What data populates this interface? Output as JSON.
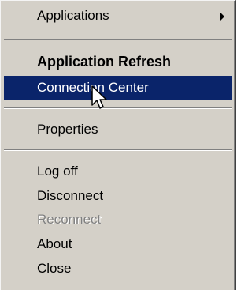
{
  "menu": {
    "applications": {
      "label": "Applications",
      "has_submenu": true
    },
    "items_group1": [
      {
        "label": "Application Refresh",
        "bold": true
      },
      {
        "label": "Connection Center",
        "selected": true
      }
    ],
    "properties": {
      "label": "Properties"
    },
    "items_group3": [
      {
        "label": "Log off"
      },
      {
        "label": "Disconnect"
      },
      {
        "label": "Reconnect",
        "disabled": true
      },
      {
        "label": "About"
      },
      {
        "label": "Close"
      }
    ]
  },
  "colors": {
    "menu_background": "#d4d0c8",
    "highlight": "#0a246a",
    "highlight_text": "#ffffff",
    "disabled_text": "#808080"
  },
  "icons": {
    "submenu_arrow": "chevron-right-icon",
    "cursor": "mouse-pointer-icon"
  }
}
